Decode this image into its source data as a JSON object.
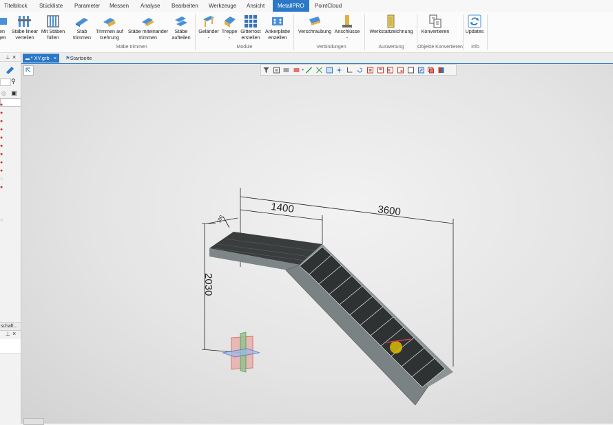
{
  "menu_tabs": [
    {
      "label": "Titelblock"
    },
    {
      "label": "Stückliste"
    },
    {
      "label": "Parameter"
    },
    {
      "label": "Messen"
    },
    {
      "label": "Analyse"
    },
    {
      "label": "Bearbeiten"
    },
    {
      "label": "Werkzeuge"
    },
    {
      "label": "Ansicht"
    },
    {
      "label": "MetallPRO",
      "active": true
    },
    {
      "label": "PointCloud"
    }
  ],
  "ribbon": {
    "buttons": [
      {
        "label": "en\ngen",
        "icon": "tool-icon"
      },
      {
        "label": "Stäbe linear\nverteilen",
        "icon": "distribute-bars-icon"
      },
      {
        "label": "Mit Stäben\nfüllen",
        "icon": "fill-bars-icon"
      },
      {
        "label": "Stab\ntrimmen",
        "icon": "trim-bar-icon"
      },
      {
        "label": "Trimmen auf\nGehrung",
        "icon": "miter-trim-icon"
      },
      {
        "label": "Stäbe miteinander\ntrimmen",
        "icon": "trim-bars-together-icon"
      },
      {
        "label": "Stäbe\naufteilen",
        "icon": "split-bars-icon"
      },
      {
        "label": "Geländer\n-",
        "icon": "railing-icon"
      },
      {
        "label": "Treppe\n-",
        "icon": "stair-icon"
      },
      {
        "label": "Gitterrost\nerstellen",
        "icon": "grating-icon"
      },
      {
        "label": "Ankerplatte\nerstellen",
        "icon": "anchor-plate-icon"
      },
      {
        "label": "Verschraubung",
        "icon": "bolting-icon"
      },
      {
        "label": "Anschlüsse\n-",
        "icon": "connections-icon"
      },
      {
        "label": "Werkstattzeichnung",
        "icon": "shop-drawing-icon"
      },
      {
        "label": "Konvertieren",
        "icon": "convert-icon"
      },
      {
        "label": "Updates",
        "icon": "updates-icon"
      }
    ],
    "groups": [
      {
        "label": "Stäbe trimmen"
      },
      {
        "label": "Module"
      },
      {
        "label": "Verbindungen"
      },
      {
        "label": "Auswertung"
      },
      {
        "label": "Objekte Konvertieren"
      },
      {
        "label": "Info"
      }
    ]
  },
  "left_panel": {
    "properties_label": "schaft..."
  },
  "document_tabs": [
    {
      "label": "* XY.grb",
      "active": true
    },
    {
      "label": "Startseite"
    }
  ],
  "drawing": {
    "dim_1400": "1400",
    "dim_3600": "3600",
    "dim_2030": "2030",
    "dim_small": "100"
  },
  "colors": {
    "accent": "#2b78c8",
    "steel": "#7d8586",
    "grating": "#3a3d3e"
  }
}
